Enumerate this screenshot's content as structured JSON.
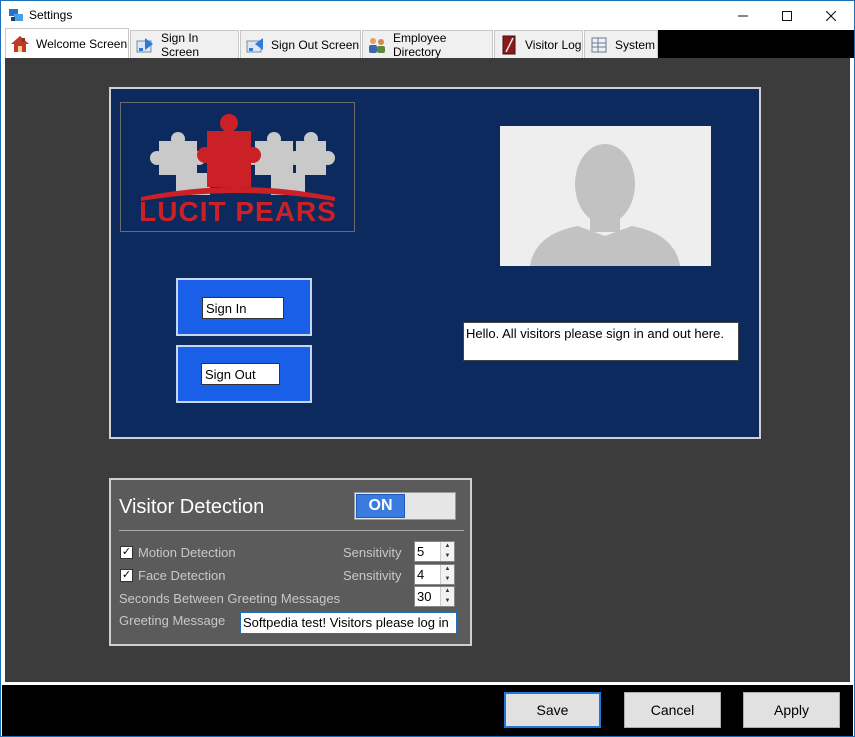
{
  "window": {
    "title": "Settings"
  },
  "tabs": [
    {
      "label": "Welcome Screen",
      "icon": "house-icon"
    },
    {
      "label": "Sign In Screen",
      "icon": "sign-in-icon"
    },
    {
      "label": "Sign Out Screen",
      "icon": "sign-out-icon"
    },
    {
      "label": "Employee Directory",
      "icon": "people-icon"
    },
    {
      "label": "Visitor Log",
      "icon": "book-icon"
    },
    {
      "label": "System",
      "icon": "system-icon"
    }
  ],
  "preview": {
    "logo_text": "LUCIT PEARS",
    "sign_in_label": "Sign In",
    "sign_out_label": "Sign Out",
    "greeting_text": "Hello. All visitors please sign in and out here."
  },
  "visitor_detection": {
    "title": "Visitor Detection",
    "toggle_label": "ON",
    "motion_label": "Motion Detection",
    "motion_checked": true,
    "motion_sensitivity_label": "Sensitivity",
    "motion_sensitivity": "5",
    "face_label": "Face Detection",
    "face_checked": true,
    "face_sensitivity_label": "Sensitivity",
    "face_sensitivity": "4",
    "seconds_label": "Seconds Between Greeting Messages",
    "seconds_value": "30",
    "greeting_label": "Greeting Message",
    "greeting_value": "Softpedia test! Visitors please log in"
  },
  "buttons": {
    "save": "Save",
    "cancel": "Cancel",
    "apply": "Apply"
  },
  "colors": {
    "preview_bg": "#0d2a5f",
    "button_blue": "#1a5fe8",
    "panel_gray": "#5b5b5b",
    "accent": "#1e78d7"
  }
}
